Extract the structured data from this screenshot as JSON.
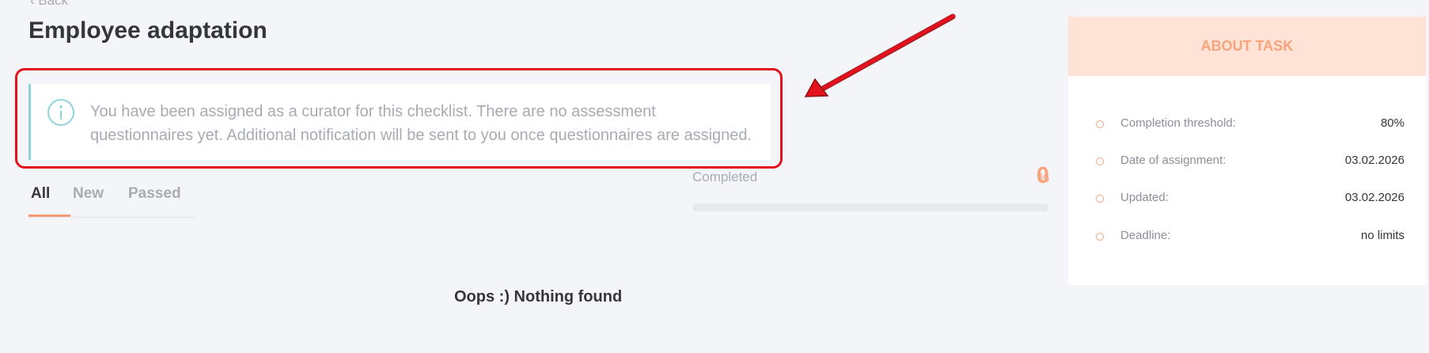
{
  "header": {
    "back_label": "Back",
    "title": "Employee adaptation"
  },
  "notice": {
    "icon": "info-icon",
    "text": "You have been assigned as a curator for this checklist. There are no assessment questionnaires yet. Additional notification will be sent to you once questionnaires are assigned."
  },
  "tabs": [
    {
      "label": "All",
      "active": true
    },
    {
      "label": "New",
      "active": false
    },
    {
      "label": "Passed",
      "active": false
    }
  ],
  "progress": {
    "label": "Completed",
    "value": "0",
    "unit": "%",
    "fraction": 0
  },
  "empty_state": "Oops :) Nothing found",
  "about": {
    "title": "ABOUT TASK",
    "rows": [
      {
        "label": "Completion threshold:",
        "value": "80%"
      },
      {
        "label": "Date of assignment:",
        "value": "03.02.2026"
      },
      {
        "label": "Updated:",
        "value": "03.02.2026"
      },
      {
        "label": "Deadline:",
        "value": "no limits"
      }
    ]
  },
  "colors": {
    "accent": "#f79a73",
    "annotation": "#e3121c",
    "info": "#8fd3dd"
  }
}
